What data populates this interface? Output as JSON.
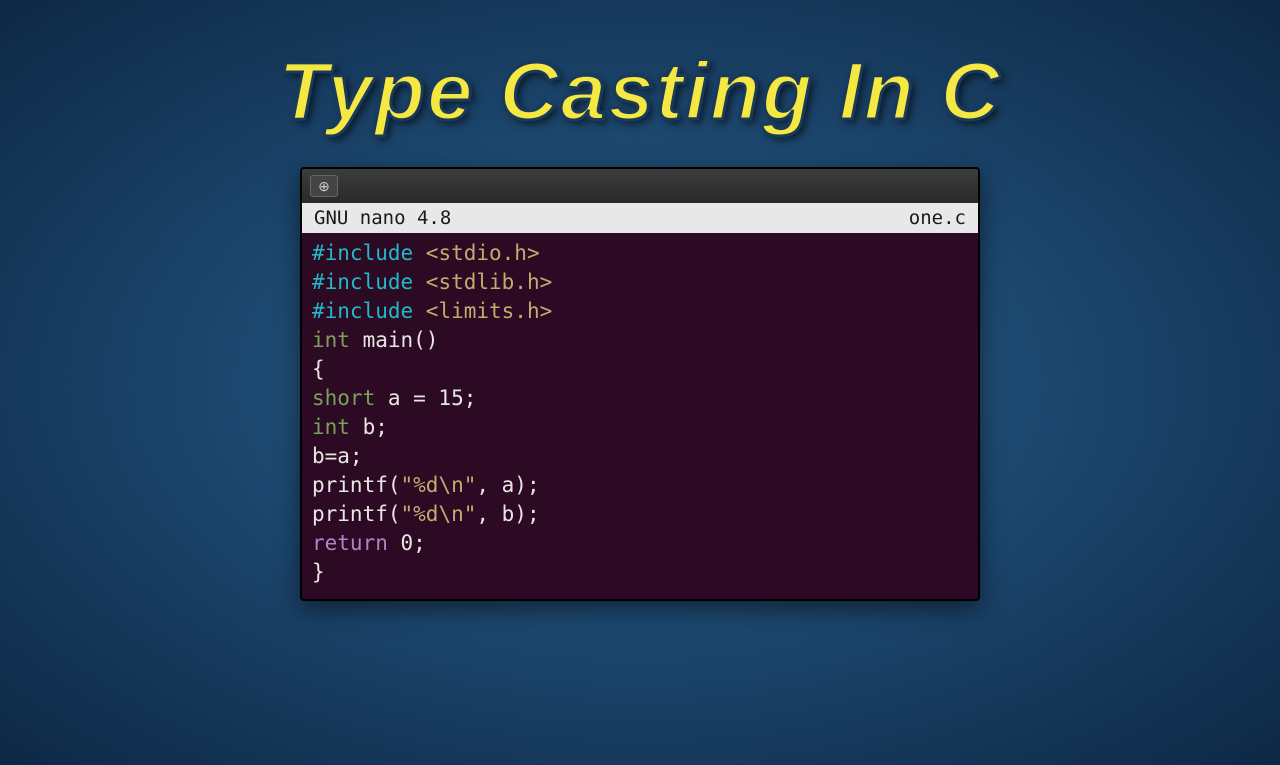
{
  "title": "Type Casting In C",
  "nano": {
    "editor_label": "GNU nano 4.8",
    "filename": "one.c"
  },
  "code": {
    "include1_kw": "#include",
    "include1_hdr": " <stdio.h>",
    "include2_kw": "#include",
    "include2_hdr": " <stdlib.h>",
    "include3_kw": "#include",
    "include3_hdr": " <limits.h>",
    "main_type": "int",
    "main_rest": " main()",
    "brace_open": "{",
    "short_kw": "short",
    "short_rest": " a = 15;",
    "int_kw": "int",
    "int_rest": " b;",
    "assign": "b=a;",
    "printf1_a": "printf(",
    "printf1_str": "\"%d\\n\"",
    "printf1_b": ", a);",
    "printf2_a": "printf(",
    "printf2_str": "\"%d\\n\"",
    "printf2_b": ", b);",
    "return_kw": "return",
    "return_rest": " 0;",
    "brace_close": "}"
  },
  "tab_icon_glyph": "⊕"
}
